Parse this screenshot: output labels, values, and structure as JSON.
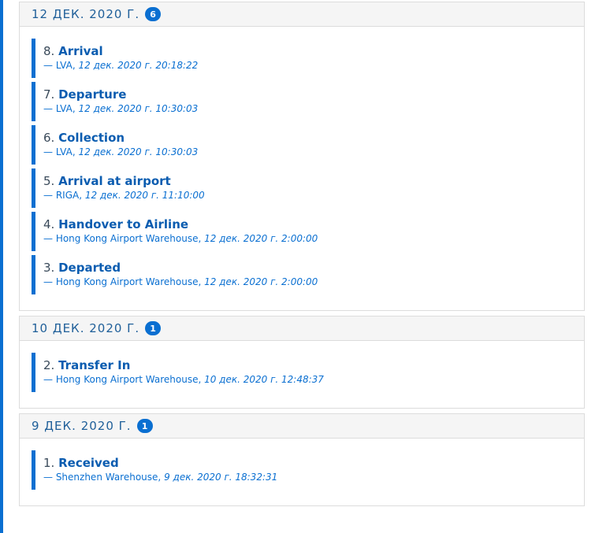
{
  "groups": [
    {
      "date": "12 ДЕК. 2020 Г.",
      "count": "6",
      "events": [
        {
          "num": "8.",
          "name": "Arrival",
          "location": "— LVA,",
          "time": "12 дек. 2020 г. 20:18:22"
        },
        {
          "num": "7.",
          "name": "Departure",
          "location": "— LVA,",
          "time": "12 дек. 2020 г. 10:30:03"
        },
        {
          "num": "6.",
          "name": "Collection",
          "location": "— LVA,",
          "time": "12 дек. 2020 г. 10:30:03"
        },
        {
          "num": "5.",
          "name": "Arrival at airport",
          "location": "— RIGA,",
          "time": "12 дек. 2020 г. 11:10:00"
        },
        {
          "num": "4.",
          "name": "Handover to Airline",
          "location": "— Hong Kong Airport Warehouse,",
          "time": "12 дек. 2020 г. 2:00:00"
        },
        {
          "num": "3.",
          "name": "Departed",
          "location": "— Hong Kong Airport Warehouse,",
          "time": "12 дек. 2020 г. 2:00:00"
        }
      ]
    },
    {
      "date": "10 ДЕК. 2020 Г.",
      "count": "1",
      "events": [
        {
          "num": "2.",
          "name": "Transfer In",
          "location": "— Hong Kong Airport Warehouse,",
          "time": "10 дек. 2020 г. 12:48:37"
        }
      ]
    },
    {
      "date": "9 ДЕК. 2020 Г.",
      "count": "1",
      "events": [
        {
          "num": "1.",
          "name": "Received",
          "location": "— Shenzhen Warehouse,",
          "time": "9 дек. 2020 г. 18:32:31"
        }
      ]
    }
  ]
}
